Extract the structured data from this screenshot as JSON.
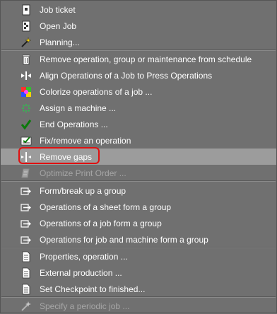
{
  "menu": {
    "items": [
      {
        "label": "Job ticket",
        "icon": "job-ticket-icon",
        "enabled": true
      },
      {
        "label": "Open Job",
        "icon": "open-job-icon",
        "enabled": true
      },
      {
        "label": "Planning...",
        "icon": "planning-wand-icon",
        "enabled": true
      },
      {
        "label": "Remove operation, group or maintenance from schedule",
        "icon": "trash-icon",
        "enabled": true
      },
      {
        "label": "Align Operations of a Job to Press Operations",
        "icon": "align-arrows-icon",
        "enabled": true
      },
      {
        "label": "Colorize operations of a job ...",
        "icon": "color-wheel-icon",
        "enabled": true
      },
      {
        "label": "Assign a machine ...",
        "icon": "assign-machine-icon",
        "enabled": true
      },
      {
        "label": "End Operations ...",
        "icon": "checkmark-icon",
        "enabled": true
      },
      {
        "label": "Fix/remove an operation",
        "icon": "fix-operation-icon",
        "enabled": true
      },
      {
        "label": "Remove gaps",
        "icon": "remove-gaps-icon",
        "enabled": true,
        "highlighted": true
      },
      {
        "label": "Optimize Print Order ...",
        "icon": "optimize-icon",
        "enabled": false
      },
      {
        "label": "Form/break up a group",
        "icon": "group-arrow-icon",
        "enabled": true
      },
      {
        "label": "Operations of a sheet form a group",
        "icon": "group-arrow-icon",
        "enabled": true
      },
      {
        "label": "Operations of a job form a group",
        "icon": "group-arrow-icon",
        "enabled": true
      },
      {
        "label": "Operations for job and machine form a group",
        "icon": "group-arrow-icon",
        "enabled": true
      },
      {
        "label": "Properties, operation ...",
        "icon": "document-icon",
        "enabled": true
      },
      {
        "label": "External production ...",
        "icon": "document-icon",
        "enabled": true
      },
      {
        "label": "Set Checkpoint to finished...",
        "icon": "document-icon",
        "enabled": true
      },
      {
        "label": "Specify a periodic job ...",
        "icon": "magic-wand-icon",
        "enabled": false
      }
    ]
  },
  "colors": {
    "menu_background": "#707070",
    "highlight": "#9c9c9c",
    "callout": "#e01010",
    "text": "#ffffff",
    "disabled_text": "#a6a6a6"
  }
}
